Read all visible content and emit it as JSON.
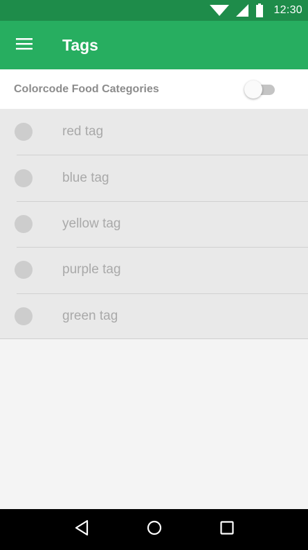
{
  "status_bar": {
    "time": "12:30",
    "icons": [
      "wifi-icon",
      "signal-icon",
      "battery-icon"
    ]
  },
  "app_bar": {
    "title": "Tags",
    "menu_icon": "hamburger-menu-icon",
    "background": "#27ae60",
    "status_background": "#1e8c4a"
  },
  "settings": {
    "colorcode_label": "Colorcode Food Categories",
    "colorcode_enabled": false
  },
  "tags": [
    {
      "label": "red tag"
    },
    {
      "label": "blue tag"
    },
    {
      "label": "yellow tag"
    },
    {
      "label": "purple tag"
    },
    {
      "label": "green tag"
    }
  ],
  "nav_bar": {
    "buttons": [
      "back-icon",
      "home-icon",
      "recents-icon"
    ]
  }
}
